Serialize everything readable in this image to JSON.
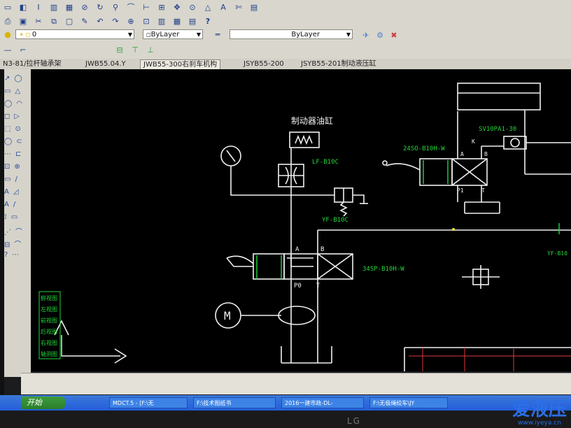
{
  "toolbar": {
    "layer_value": "0",
    "color_value": "ByLayer",
    "linetype_value": "ByLayer",
    "help_symbol": "?"
  },
  "tabs": [
    {
      "label": "N3-81/拉杆轴承架",
      "active": false
    },
    {
      "label": "JWB55.04.Y",
      "active": false
    },
    {
      "label": "JWB55-300右刹车机构",
      "active": true
    },
    {
      "label": "JSYB55-200",
      "active": false
    },
    {
      "label": "JSYB55-201制动液压缸",
      "active": false
    }
  ],
  "drawing": {
    "brake_cylinder_label": "制动器油缸",
    "throttle_label": "LF-B10C",
    "relief_valve_label": "YF-B10C",
    "main_valve_label": "34SP-B10H-W",
    "port_a": "A",
    "port_b": "B",
    "port_p0": "P0",
    "port_t": "T",
    "motor_label": "M",
    "right_valve_label": "24SO-B10H-W",
    "right_relief_label": "SV10PA1-30",
    "right_port_k": "K",
    "right_port_a": "A",
    "right_port_b": "B",
    "right_port_p1": "P1",
    "right_port_t": "T",
    "edge_relief_label": "YF-B10"
  },
  "left_panel": {
    "green_labels": [
      "俯视图",
      "左视图",
      "前视图",
      "后视图",
      "右视图",
      "轴测图"
    ]
  },
  "taskbar": {
    "start_label": "开始",
    "items": [
      "MDCT.5 - [F:\\无",
      "F:\\技术图纸书",
      "2016一建市政-DL-",
      "F:\\无极绳绞车\\JY"
    ]
  },
  "monitor": {
    "brand": "LG"
  },
  "watermark": {
    "title": "爱液压",
    "url": "www.iyeya.cn"
  },
  "colors": {
    "canvas_bg": "#000000",
    "line_white": "#f0f0f0",
    "label_green": "#22d63a",
    "label_yellow": "#f0e63c",
    "arrow_red": "#e23a3a"
  }
}
